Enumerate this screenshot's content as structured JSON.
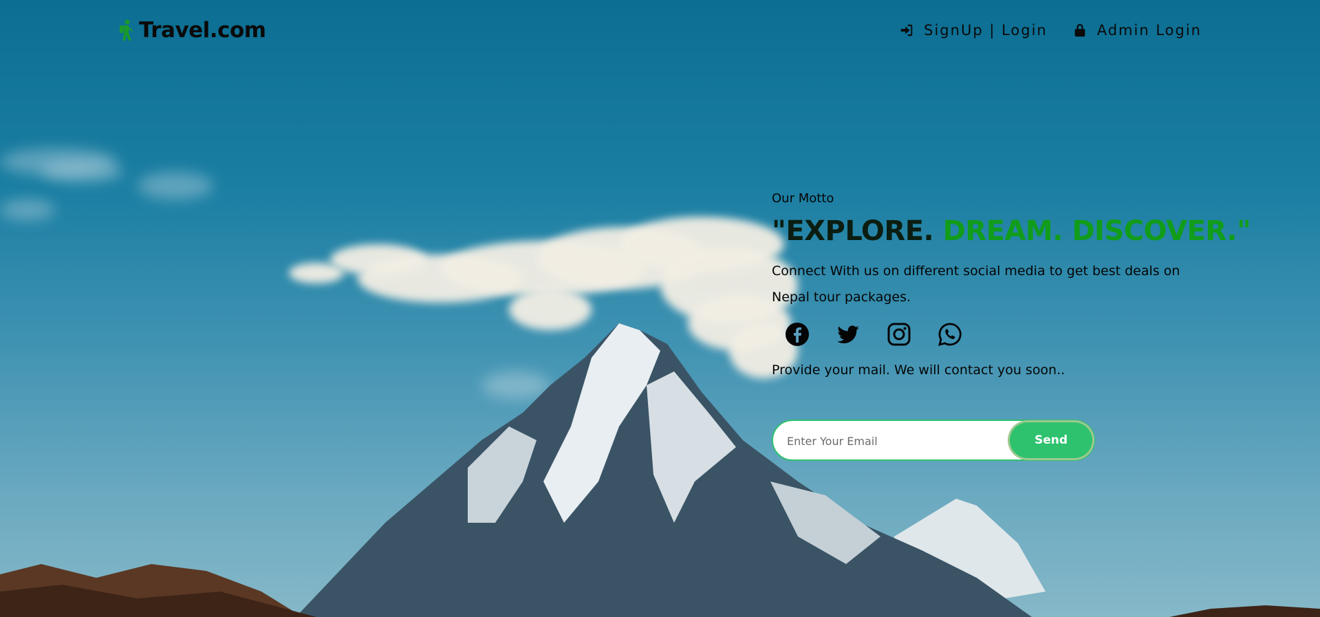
{
  "header": {
    "logo_text": "Travel.com",
    "logo_icon": "hiker-icon",
    "nav": [
      {
        "label": "SignUp | Login",
        "icon": "sign-in-icon"
      },
      {
        "label": "Admin Login",
        "icon": "lock-icon"
      }
    ]
  },
  "hero": {
    "motto_label": "Our Motto",
    "headline_dark": "\"EXPLORE. ",
    "headline_green": "DREAM. DISCOVER.\"",
    "connect_text": "Connect With us on different social media to get best deals on Nepal tour packages.",
    "socials": [
      "facebook-icon",
      "twitter-icon",
      "instagram-icon",
      "whatsapp-icon"
    ],
    "provide_text": "Provide your mail. We will contact you soon..",
    "email_placeholder": "Enter Your Email",
    "send_label": "Send"
  },
  "colors": {
    "accent_green": "#2ec26e",
    "headline_green": "#119c1a",
    "logo_green": "#1a9a2a"
  }
}
